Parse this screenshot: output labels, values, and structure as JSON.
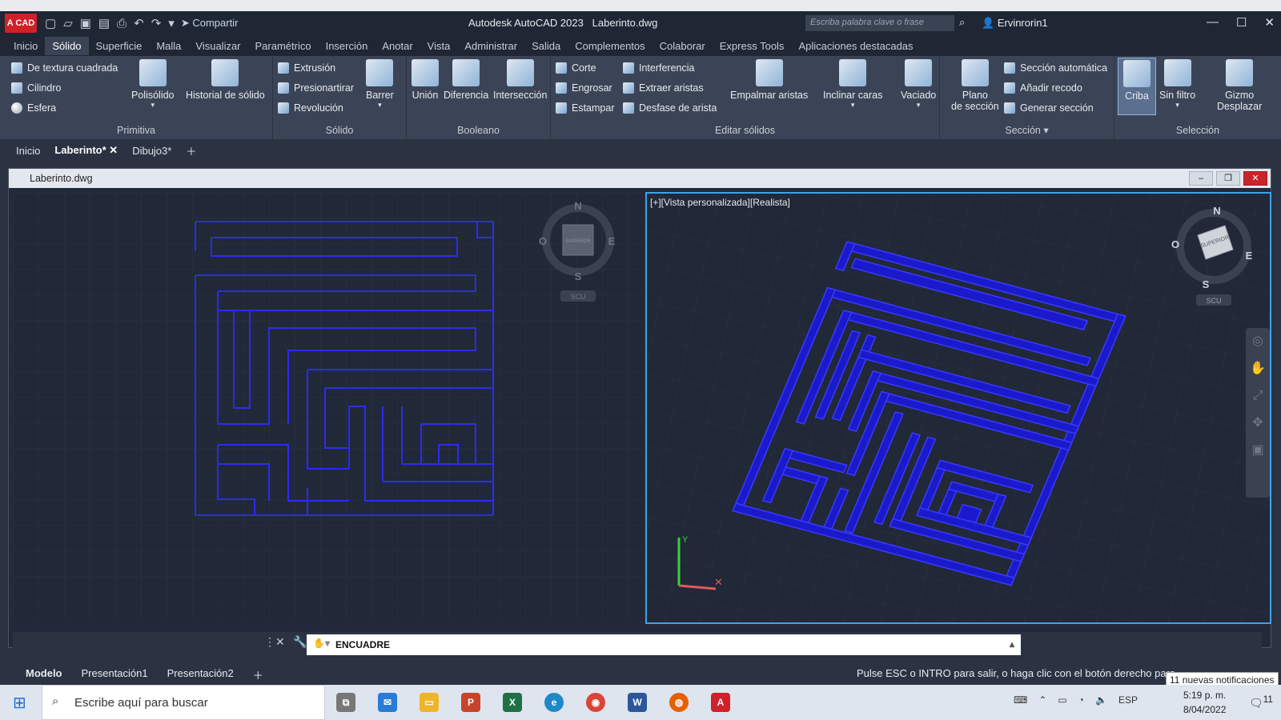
{
  "app": {
    "logo_text": "A CAD",
    "title": "Autodesk AutoCAD 2023",
    "filename": "Laberinto.dwg",
    "share": "Compartir",
    "search_placeholder": "Escriba palabra clave o frase",
    "user": "Ervinrorin1"
  },
  "menu_tabs": [
    "Inicio",
    "Sólido",
    "Superficie",
    "Malla",
    "Visualizar",
    "Paramétrico",
    "Inserción",
    "Anotar",
    "Vista",
    "Administrar",
    "Salida",
    "Complementos",
    "Colaborar",
    "Express Tools",
    "Aplicaciones destacadas"
  ],
  "active_menu_tab": "Sólido",
  "ribbon": {
    "primitiva": {
      "title": "Primitiva",
      "items": [
        "De textura cuadrada",
        "Cilindro",
        "Esfera"
      ],
      "big": [
        "Polisólido",
        "Historial de sólido"
      ]
    },
    "solido": {
      "title": "Sólido",
      "items": [
        "Extrusión",
        "Presionartirar",
        "Revolución"
      ],
      "big": [
        "Barrer"
      ]
    },
    "booleano": {
      "title": "Booleano",
      "big": [
        "Unión",
        "Diferencia",
        "Intersección"
      ]
    },
    "editar": {
      "title": "Editar sólidos",
      "items_a": [
        "Corte",
        "Engrosar",
        "Estampar"
      ],
      "items_b": [
        "Interferencia",
        "Extraer aristas",
        "Desfase de arista"
      ],
      "big": [
        "Empalmar aristas",
        "Inclinar caras",
        "Vaciado"
      ]
    },
    "seccion": {
      "title": "Sección",
      "big_top": "Plano",
      "big_bottom": "de sección",
      "items": [
        "Sección automática",
        "Añadir recodo",
        "Generar sección"
      ]
    },
    "seleccion": {
      "title": "Selección",
      "big": [
        "Criba",
        "Sin filtro"
      ],
      "gizmo_top": "Gizmo",
      "gizmo_bottom": "Desplazar"
    }
  },
  "doc_tabs": [
    "Inicio",
    "Laberinto*",
    "Dibujo3*"
  ],
  "drawing_window_title": "Laberinto.dwg",
  "viewport_right_label": "[+][Vista personalizada][Realista]",
  "viewcube": {
    "n": "N",
    "s": "S",
    "e": "E",
    "w": "O",
    "face": "SUPERIOR",
    "ucs": "SCU"
  },
  "command_line": "ENCUADRE",
  "layout_tabs": [
    "Modelo",
    "Presentación1",
    "Presentación2"
  ],
  "status_message": "Pulse ESC o INTRO para salir, o haga clic con el botón derecho para",
  "notifications": "11 nuevas notificaciones",
  "taskbar": {
    "search": "Escribe aquí para buscar",
    "lang": "ESP",
    "time": "5:19 p. m.",
    "date": "8/04/2022",
    "badge": "11"
  },
  "colors": {
    "maze": "#2b2bf0",
    "accent": "#3ea2e8",
    "ribbon": "#3b4456",
    "titlebar": "#1f2734",
    "autocad_red": "#d02028"
  }
}
